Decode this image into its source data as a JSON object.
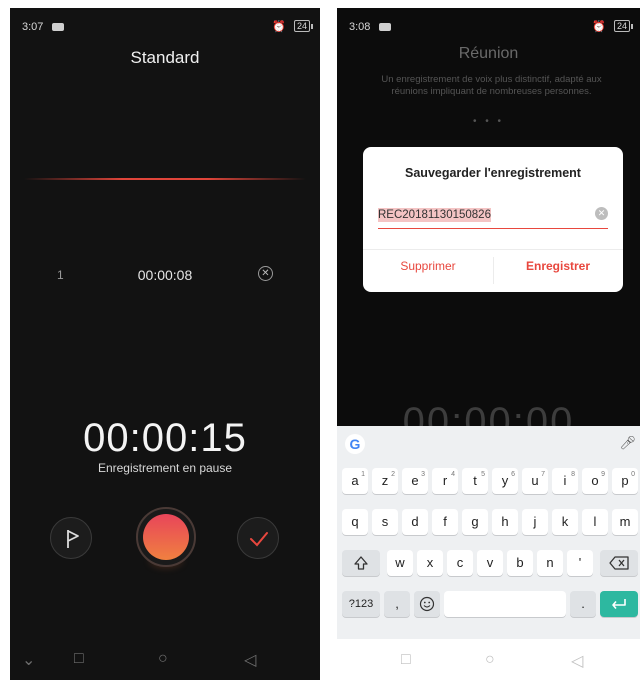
{
  "left": {
    "status": {
      "time": "3:07",
      "battery": "24"
    },
    "mode_title": "Standard",
    "marker": {
      "index": "1",
      "time": "00:00:08"
    },
    "timer": "00:00:15",
    "state": "Enregistrement en pause",
    "icons": {
      "flag": "flag-icon",
      "record": "record-icon",
      "check": "check-icon",
      "delete": "close-icon"
    },
    "nav": [
      "chevron-down-icon",
      "square-icon",
      "circle-icon",
      "back-triangle-icon"
    ]
  },
  "right": {
    "status": {
      "time": "3:08",
      "battery": "24"
    },
    "mode_title": "Réunion",
    "mode_desc": "Un enregistrement de voix plus distinctif, adapté aux réunions impliquant de nombreuses personnes.",
    "dots": "• • •",
    "timer_partial": "00:00:00",
    "dialog": {
      "title": "Sauvegarder l'enregistrement",
      "filename": "REC20181130150826",
      "delete_label": "Supprimer",
      "save_label": "Enregistrer"
    },
    "keyboard": {
      "row1": [
        "a",
        "z",
        "e",
        "r",
        "t",
        "y",
        "u",
        "i",
        "o",
        "p"
      ],
      "row1_hints": [
        "1",
        "2",
        "3",
        "4",
        "5",
        "6",
        "7",
        "8",
        "9",
        "0"
      ],
      "row2": [
        "q",
        "s",
        "d",
        "f",
        "g",
        "h",
        "j",
        "k",
        "l",
        "m"
      ],
      "row3": [
        "w",
        "x",
        "c",
        "v",
        "b",
        "n",
        "'"
      ],
      "fn_label": "?123",
      "comma": ",",
      "period": "."
    }
  },
  "colors": {
    "accent": "#e8473e",
    "record_top": "#e8455a",
    "record_bottom": "#f08040",
    "enter": "#2db8a0"
  }
}
